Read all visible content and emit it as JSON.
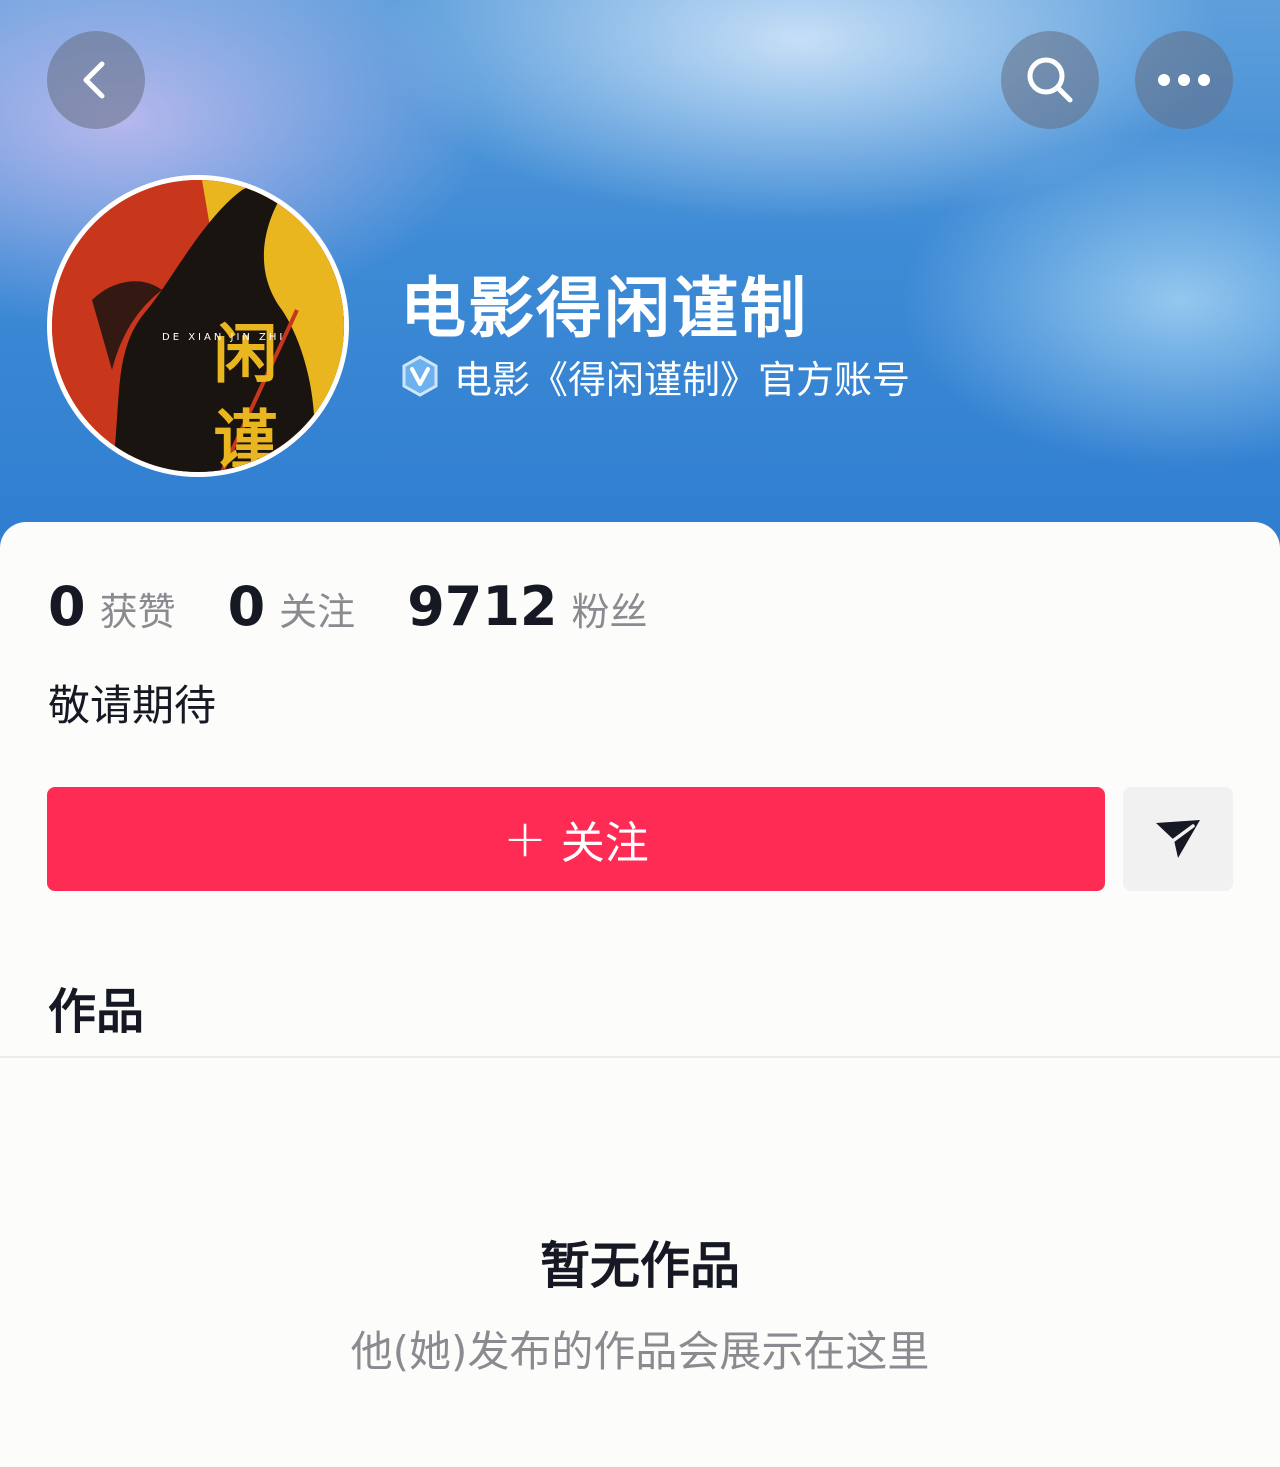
{
  "header": {
    "back_icon": "chevron-left-icon",
    "search_icon": "search-icon",
    "more_icon": "more-horizontal-icon"
  },
  "profile": {
    "avatar": {
      "title_chars": "闲 谨",
      "subtitle": "DE XIAN JIN ZHI"
    },
    "name": "电影得闲谨制",
    "verified_icon": "verified-badge-icon",
    "verification": "电影《得闲谨制》官方账号"
  },
  "stats": [
    {
      "value": "0",
      "label": "获赞"
    },
    {
      "value": "0",
      "label": "关注"
    },
    {
      "value": "9712",
      "label": "粉丝"
    }
  ],
  "bio": "敬请期待",
  "actions": {
    "follow_plus": "+",
    "follow_label": "关注",
    "message_icon": "send-icon"
  },
  "tabs": {
    "works": "作品"
  },
  "empty_state": {
    "title": "暂无作品",
    "subtitle": "他(她)发布的作品会展示在这里"
  },
  "colors": {
    "accent": "#fe2c55",
    "banner": "#3d8ad5"
  }
}
